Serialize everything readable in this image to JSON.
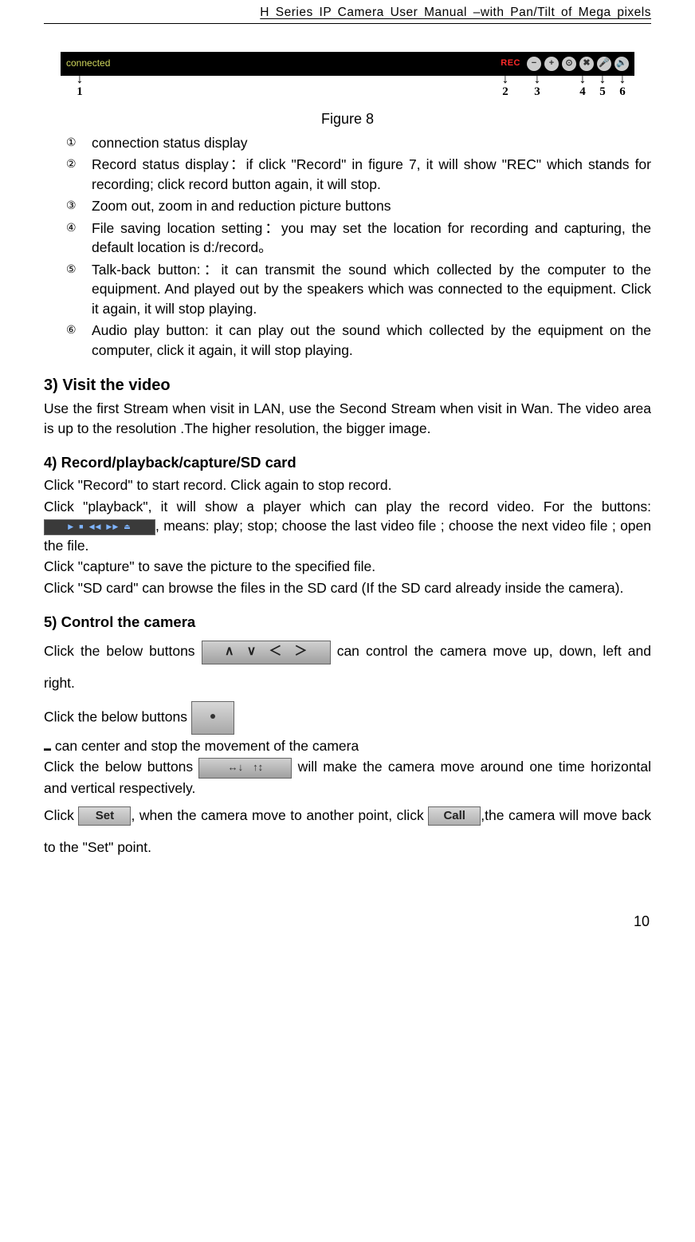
{
  "header": "H Series IP Camera User Manual –with Pan/Tilt of Mega pixels",
  "figure": {
    "toolbar_left_label": "connected",
    "toolbar_rec": "REC",
    "arrows": [
      "1",
      "2",
      "3",
      "4",
      "5",
      "6"
    ],
    "caption": "Figure 8"
  },
  "list_items": [
    {
      "marker": "①",
      "text": "connection status display"
    },
    {
      "marker": "②",
      "text": "Record status display：if click \"Record\" in figure 7, it will show \"REC\" which stands for recording; click record button again, it will stop."
    },
    {
      "marker": "③",
      "text": "Zoom out, zoom in and reduction picture buttons"
    },
    {
      "marker": "④",
      "text": "File saving location setting：you may set the location for recording and capturing, the default location is d:/record。"
    },
    {
      "marker": "⑤",
      "text": "Talk-back button:：it can transmit the sound which collected by the computer to the equipment. And played out by the speakers which was connected to the equipment. Click it again, it will stop playing."
    },
    {
      "marker": "⑥",
      "text": "Audio play button: it can play out the sound which collected by the equipment on the computer, click it again, it will stop playing."
    }
  ],
  "section3": {
    "title": "3) Visit the video",
    "body": "Use the first Stream when visit in LAN, use the Second Stream when visit in Wan. The video area is up to the resolution .The higher resolution, the bigger image."
  },
  "section4": {
    "title": "4) Record/playback/capture/SD card",
    "p1": "Click \"Record\" to start record. Click again to stop record.",
    "p2a": "Click \"playback\", it will show a player which can play the record video. For the buttons: ",
    "p2b": ", means: play; stop; choose the last video file ; choose the next video file ; open the file.",
    "p3": "Click \"capture\" to save the picture to the specified file.",
    "p4": "Click \"SD card\" can browse the files in the SD card (If the SD card already inside the camera)."
  },
  "section5": {
    "title": "5) Control the camera",
    "p1a": "Click the below buttons ",
    "p1b": " can control the camera move up, down, left and right.",
    "p2a": "Click the below buttons ",
    "p2b": " can center and stop the movement of the camera",
    "p3a": "Click the below buttons ",
    "p3b": " will make the camera move around one time horizontal and vertical respectively.",
    "p4a": "Click ",
    "p4b": ", when the camera move to another point, click ",
    "p4c": ",the camera will move back to the \"Set\" point.",
    "set_label": "Set",
    "call_label": "Call"
  },
  "page_number": "10"
}
